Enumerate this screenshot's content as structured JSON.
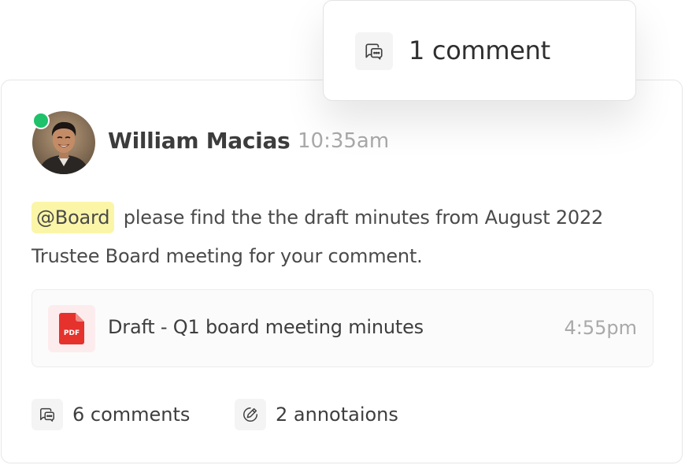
{
  "popup": {
    "icon": "chat-bubbles-icon",
    "label": "1 comment"
  },
  "post": {
    "author": "William Macias",
    "time": "10:35am",
    "presence": "online",
    "mention": "@Board",
    "message": "please find the the draft minutes from August 2022 Trustee Board meeting for your comment."
  },
  "attachment": {
    "icon": "pdf-file-icon",
    "file_badge": "PDF",
    "name": "Draft - Q1 board meeting minutes",
    "time": "4:55pm"
  },
  "stats": {
    "comments": {
      "icon": "chat-bubbles-icon",
      "label": "6 comments"
    },
    "annotations": {
      "icon": "annotation-icon",
      "label": "2 annotaions"
    }
  },
  "colors": {
    "online": "#1fc16b",
    "mention_bg": "#fbf5a8",
    "pdf_red": "#e5322d",
    "pdf_bg": "#fdecee"
  }
}
